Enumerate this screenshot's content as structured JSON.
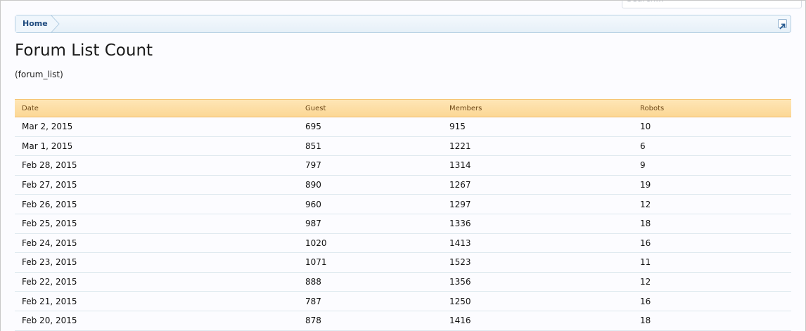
{
  "search": {
    "placeholder": "Search..."
  },
  "breadcrumb": {
    "home_label": "Home"
  },
  "page": {
    "title": "Forum List Count",
    "description": "(forum_list)"
  },
  "table": {
    "headers": {
      "date": "Date",
      "guest": "Guest",
      "members": "Members",
      "robots": "Robots"
    },
    "rows": [
      {
        "date": "Mar 2, 2015",
        "guest": "695",
        "members": "915",
        "robots": "10"
      },
      {
        "date": "Mar 1, 2015",
        "guest": "851",
        "members": "1221",
        "robots": "6"
      },
      {
        "date": "Feb 28, 2015",
        "guest": "797",
        "members": "1314",
        "robots": "9"
      },
      {
        "date": "Feb 27, 2015",
        "guest": "890",
        "members": "1267",
        "robots": "19"
      },
      {
        "date": "Feb 26, 2015",
        "guest": "960",
        "members": "1297",
        "robots": "12"
      },
      {
        "date": "Feb 25, 2015",
        "guest": "987",
        "members": "1336",
        "robots": "18"
      },
      {
        "date": "Feb 24, 2015",
        "guest": "1020",
        "members": "1413",
        "robots": "16"
      },
      {
        "date": "Feb 23, 2015",
        "guest": "1071",
        "members": "1523",
        "robots": "11"
      },
      {
        "date": "Feb 22, 2015",
        "guest": "888",
        "members": "1356",
        "robots": "12"
      },
      {
        "date": "Feb 21, 2015",
        "guest": "787",
        "members": "1250",
        "robots": "16"
      },
      {
        "date": "Feb 20, 2015",
        "guest": "878",
        "members": "1416",
        "robots": "18"
      }
    ]
  },
  "colors": {
    "header_bg": "#fcd795",
    "breadcrumb_border": "#b5cfe3",
    "link": "#1e4a7e"
  }
}
